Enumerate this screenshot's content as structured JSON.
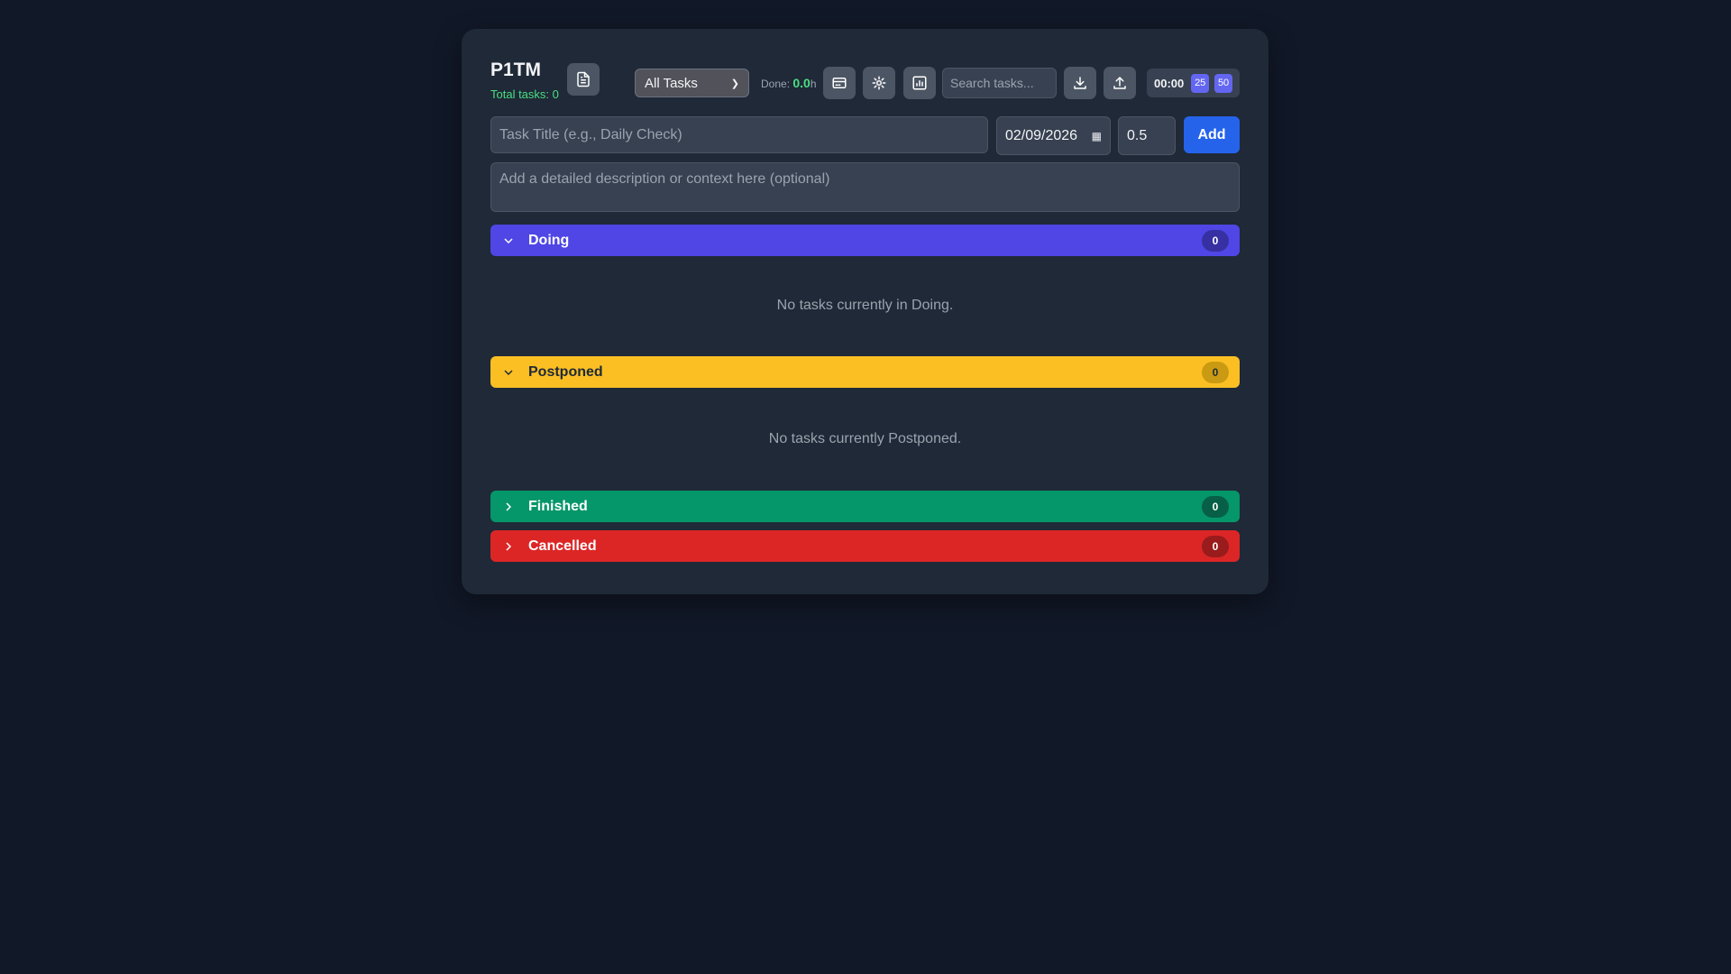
{
  "header": {
    "title": "P1TM",
    "total_tasks": "Total tasks: 0",
    "filter": "All Tasks",
    "done_label": "Done: ",
    "done_value": "0.0",
    "done_unit": "h",
    "search_placeholder": "Search tasks...",
    "timer": "00:00",
    "pomodoro": [
      "25",
      "50"
    ]
  },
  "form": {
    "title_placeholder": "Task Title (e.g., Daily Check)",
    "date": "02/09/2026",
    "hours": "0.5",
    "add_label": "Add",
    "description_placeholder": "Add a detailed description or context here (optional)"
  },
  "sections": [
    {
      "label": "Doing",
      "count": "0",
      "color": "#4f46e5",
      "expanded": true,
      "empty": "No tasks currently in Doing."
    },
    {
      "label": "Postponed",
      "count": "0",
      "color": "#fbbf24",
      "expanded": true,
      "empty": "No tasks currently Postponed."
    },
    {
      "label": "Finished",
      "count": "0",
      "color": "#059669",
      "expanded": false
    },
    {
      "label": "Cancelled",
      "count": "0",
      "color": "#dc2626",
      "expanded": false
    }
  ]
}
